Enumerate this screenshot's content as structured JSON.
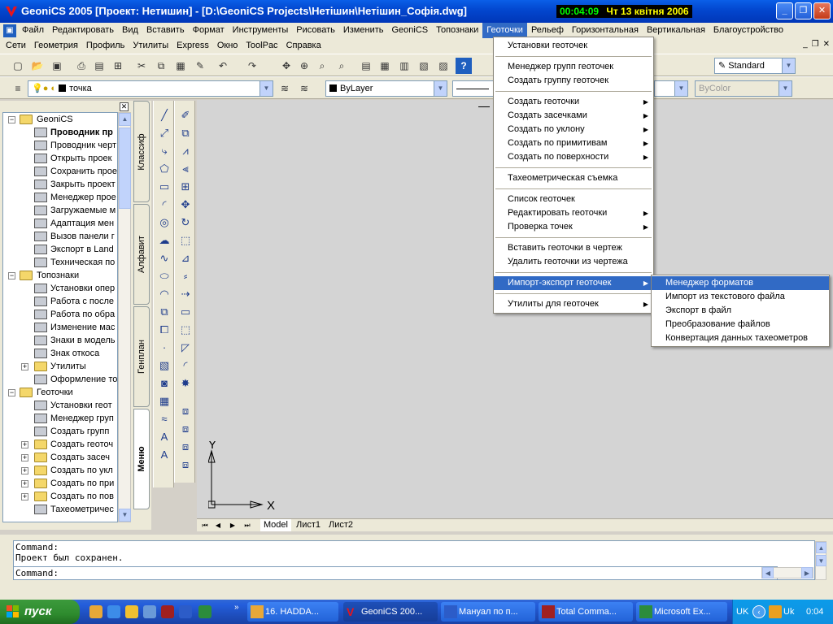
{
  "titlebar": {
    "title": "GeoniCS 2005 [Проект: Нетишин] - [D:\\GeoniCS Projects\\Нетішин\\Нетішин_Софія.dwg]",
    "time": "00:04:09",
    "date": "Чт 13 квітня 2006"
  },
  "menubar1": [
    {
      "label": "Файл"
    },
    {
      "label": "Редактировать"
    },
    {
      "label": "Вид"
    },
    {
      "label": "Вставить"
    },
    {
      "label": "Формат"
    },
    {
      "label": "Инструменты"
    },
    {
      "label": "Рисовать"
    },
    {
      "label": "Изменить"
    },
    {
      "label": "GeoniCS"
    },
    {
      "label": "Топознаки"
    },
    {
      "label": "Геоточки"
    },
    {
      "label": "Рельеф"
    },
    {
      "label": "Горизонтальная"
    },
    {
      "label": "Вертикальная"
    },
    {
      "label": "Благоустройство"
    }
  ],
  "menubar2": [
    {
      "label": "Сети"
    },
    {
      "label": "Геометрия"
    },
    {
      "label": "Профиль"
    },
    {
      "label": "Утилиты"
    },
    {
      "label": "Express"
    },
    {
      "label": "Окно"
    },
    {
      "label": "ToolPac"
    },
    {
      "label": "Справка"
    }
  ],
  "toolbar": {
    "text_style": "Standard",
    "layer": "точка",
    "color": "ByLayer",
    "plot_style": "ByColor"
  },
  "tree": [
    {
      "label": "GeoniCS",
      "level": 0,
      "type": "folder",
      "expander": "⊟"
    },
    {
      "label": "Проводник пр",
      "level": 1,
      "type": "cmd",
      "bold": true
    },
    {
      "label": "Проводник черт",
      "level": 1,
      "type": "cmd"
    },
    {
      "label": "Открыть проек",
      "level": 1,
      "type": "cmd"
    },
    {
      "label": "Сохранить прое",
      "level": 1,
      "type": "cmd"
    },
    {
      "label": "Закрыть проект",
      "level": 1,
      "type": "cmd"
    },
    {
      "label": "Менеджер прое",
      "level": 1,
      "type": "cmd"
    },
    {
      "label": "Загружаемые м",
      "level": 1,
      "type": "cmd"
    },
    {
      "label": "Адаптация мен",
      "level": 1,
      "type": "cmd"
    },
    {
      "label": "Вызов панели г",
      "level": 1,
      "type": "cmd"
    },
    {
      "label": "Экспорт в Land",
      "level": 1,
      "type": "cmd"
    },
    {
      "label": "Техническая по",
      "level": 1,
      "type": "cmd"
    },
    {
      "label": "Топознаки",
      "level": 0,
      "type": "folder",
      "expander": "⊟"
    },
    {
      "label": "Установки опер",
      "level": 1,
      "type": "cmd"
    },
    {
      "label": "Работа с после",
      "level": 1,
      "type": "cmd"
    },
    {
      "label": "Работа по обра",
      "level": 1,
      "type": "cmd"
    },
    {
      "label": "Изменение мас",
      "level": 1,
      "type": "cmd"
    },
    {
      "label": "Знаки в модель",
      "level": 1,
      "type": "cmd"
    },
    {
      "label": "Знак откоса",
      "level": 1,
      "type": "cmd"
    },
    {
      "label": "Утилиты",
      "level": 1,
      "type": "folder",
      "expander": "⊞"
    },
    {
      "label": "Оформление то",
      "level": 1,
      "type": "cmd"
    },
    {
      "label": "Геоточки",
      "level": 0,
      "type": "folder",
      "expander": "⊟"
    },
    {
      "label": "Установки геот",
      "level": 1,
      "type": "cmd"
    },
    {
      "label": "Менеджер груп",
      "level": 1,
      "type": "cmd"
    },
    {
      "label": "Создать групп",
      "level": 1,
      "type": "cmd"
    },
    {
      "label": "Создать геоточ",
      "level": 1,
      "type": "folder",
      "expander": "⊞"
    },
    {
      "label": "Создать засеч",
      "level": 1,
      "type": "folder",
      "expander": "⊞"
    },
    {
      "label": "Создать по укл",
      "level": 1,
      "type": "folder",
      "expander": "⊞"
    },
    {
      "label": "Создать по при",
      "level": 1,
      "type": "folder",
      "expander": "⊞"
    },
    {
      "label": "Создать по пов",
      "level": 1,
      "type": "folder",
      "expander": "⊞"
    },
    {
      "label": "Тахеометричес",
      "level": 1,
      "type": "cmd"
    }
  ],
  "vtabs": [
    {
      "label": "Классиф"
    },
    {
      "label": "Алфавит"
    },
    {
      "label": "Генплан"
    },
    {
      "label": "Меню"
    }
  ],
  "geopoints_menu": [
    {
      "label": "Установки геоточек",
      "arrow": ""
    },
    {
      "sep": true
    },
    {
      "label": "Менеджер групп геоточек",
      "arrow": ""
    },
    {
      "label": "Создать группу геоточек",
      "arrow": ""
    },
    {
      "sep": true
    },
    {
      "label": "Создать геоточки",
      "arrow": "▶"
    },
    {
      "label": "Создать засечками",
      "arrow": "▶"
    },
    {
      "label": "Создать по уклону",
      "arrow": "▶"
    },
    {
      "label": "Создать по примитивам",
      "arrow": "▶"
    },
    {
      "label": "Создать по поверхности",
      "arrow": "▶"
    },
    {
      "sep": true
    },
    {
      "label": "Тахеометрическая съемка",
      "arrow": ""
    },
    {
      "sep": true
    },
    {
      "label": "Список геоточек",
      "arrow": ""
    },
    {
      "label": "Редактировать геоточки",
      "arrow": "▶"
    },
    {
      "label": "Проверка точек",
      "arrow": "▶"
    },
    {
      "sep": true
    },
    {
      "label": "Вставить геоточки в чертеж",
      "arrow": ""
    },
    {
      "label": "Удалить геоточки из чертежа",
      "arrow": ""
    },
    {
      "sep": true
    },
    {
      "label": "Импорт-экспорт геоточек",
      "arrow": "▶",
      "highlighted": true
    },
    {
      "sep": true
    },
    {
      "label": "Утилиты для геоточек",
      "arrow": "▶"
    }
  ],
  "import_export_submenu": [
    {
      "label": "Менеджер форматов",
      "highlighted": true
    },
    {
      "label": "Импорт из текстового файла"
    },
    {
      "label": "Экспорт в файл"
    },
    {
      "label": "Преобразование файлов"
    },
    {
      "label": "Конвертация данных тахеометров"
    }
  ],
  "layout_tabs": [
    {
      "label": "Model",
      "active": true
    },
    {
      "label": "Лист1"
    },
    {
      "label": "Лист2"
    }
  ],
  "ucs": {
    "x_label": "X",
    "y_label": "Y"
  },
  "command": {
    "line1": "Command:",
    "line2": "Проект был сохранен.",
    "prompt": "Command:"
  },
  "taskbar": {
    "start_label": "пуск",
    "tasks": [
      {
        "label": "16. HADDA..."
      },
      {
        "label": "GeoniCS 200...",
        "active": true
      },
      {
        "label": "Мануал по п..."
      },
      {
        "label": "Total Comma..."
      },
      {
        "label": "Microsoft Ex..."
      }
    ],
    "lang": "UK",
    "lang2": "Uk",
    "clock": "0:04"
  },
  "colors": {
    "menu_highlight": "#316ac5",
    "drawing_bg": "#d4d4d4",
    "clock_time": "#00ff00",
    "clock_date": "#ffff00"
  }
}
